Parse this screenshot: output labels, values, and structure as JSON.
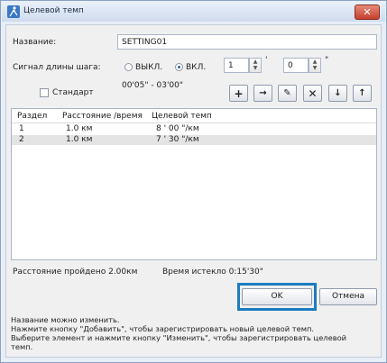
{
  "window": {
    "title": "Целевой темп",
    "close_glyph": "✕"
  },
  "name_label": "Название:",
  "name_value": "SETTING01",
  "step_signal": {
    "label": "Сигнал длины шага:",
    "off_label": "ВЫКЛ.",
    "on_label": "ВКЛ.",
    "selected": "on",
    "minutes_value": "1",
    "minutes_unit": "'",
    "seconds_value": "0",
    "seconds_unit": "\"",
    "range_text": "00'05\" - 03'00\""
  },
  "standard_checkbox": {
    "label": "Стандарт",
    "checked": false
  },
  "toolbar": {
    "add_glyph": "+",
    "insert_glyph": "→",
    "edit_glyph": "✎",
    "delete_glyph": "✕",
    "down_glyph": "↓",
    "up_glyph": "↑"
  },
  "table": {
    "headers": [
      "Раздел",
      "Расстояние /время",
      "Целевой темп"
    ],
    "rows": [
      {
        "section": "1",
        "distance": "1.0 км",
        "pace": "8 ' 00 \"/км"
      },
      {
        "section": "2",
        "distance": "1.0 км",
        "pace": "7 ' 30 \"/км"
      }
    ]
  },
  "status": {
    "distance_text": "Расстояние пройдено 2.00км",
    "time_text": "Время истекло 0:15'30\""
  },
  "buttons": {
    "ok": "OK",
    "cancel": "Отмена"
  },
  "help_lines": [
    "Название можно изменить.",
    "Нажмите кнопку \"Добавить\", чтобы зарегистрировать новый целевой темп.",
    "Выберите элемент и нажмите кнопку \"Изменить\", чтобы зарегистрировать целевой",
    "темп."
  ],
  "colors": {
    "highlight": "#1c7cc0",
    "close": "#c7412c",
    "selected_row": "#e4e4e4"
  }
}
